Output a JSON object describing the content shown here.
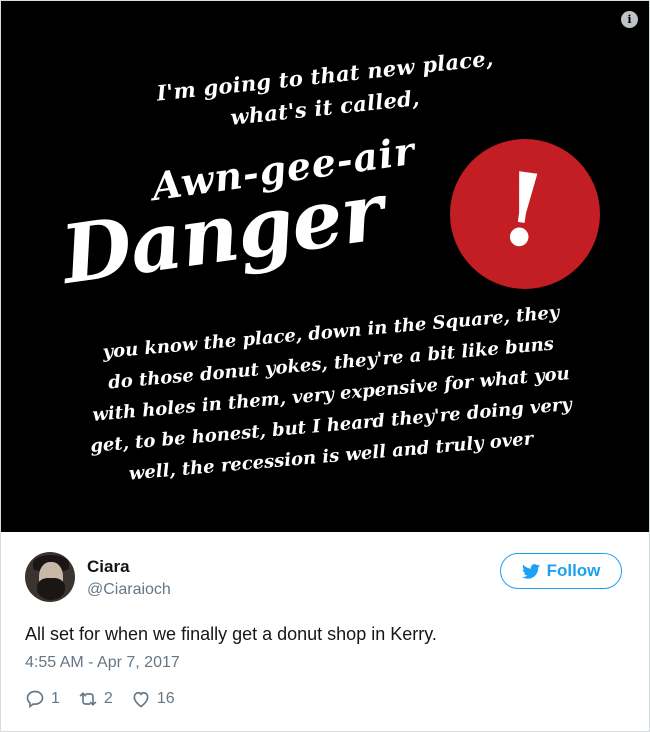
{
  "media": {
    "line1": "I'm going to that new place,",
    "line2": "what's it called,",
    "headline_small": "Awn-gee-air",
    "headline_big": "Danger",
    "exclamation": "!",
    "paragraph": [
      "you know the place, down in the Square, they",
      "do those donut yokes, they're a bit like buns",
      "with holes in them, very expensive for what you",
      "get, to be honest, but I heard they're doing very",
      "well, the recession is well and truly over"
    ],
    "info_icon": "info-icon",
    "accent_color": "#c41e25"
  },
  "tweet": {
    "name": "Ciara",
    "handle": "@Ciaraioch",
    "follow_label": "Follow",
    "text": "All set for when we finally get a donut shop in Kerry.",
    "timestamp": "4:55 AM - Apr 7, 2017",
    "replies": "1",
    "retweets": "2",
    "likes": "16",
    "brand_color": "#1da1f2"
  }
}
